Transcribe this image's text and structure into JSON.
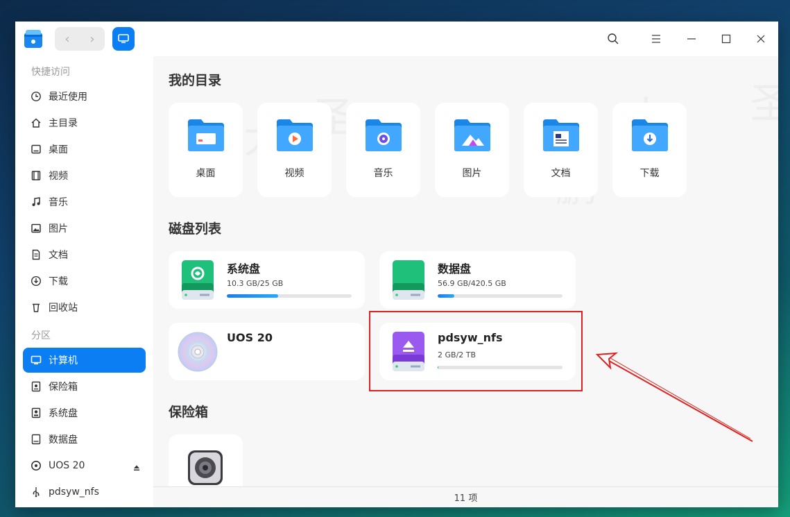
{
  "sidebar": {
    "quick_access_header": "快捷访问",
    "quick_items": [
      {
        "label": "最近使用",
        "icon": "clock-icon"
      },
      {
        "label": "主目录",
        "icon": "home-icon"
      },
      {
        "label": "桌面",
        "icon": "desktop-icon"
      },
      {
        "label": "视频",
        "icon": "video-icon"
      },
      {
        "label": "音乐",
        "icon": "music-icon"
      },
      {
        "label": "图片",
        "icon": "image-icon"
      },
      {
        "label": "文档",
        "icon": "document-icon"
      },
      {
        "label": "下载",
        "icon": "download-icon"
      },
      {
        "label": "回收站",
        "icon": "trash-icon"
      }
    ],
    "partition_header": "分区",
    "partition_items": [
      {
        "label": "计算机",
        "icon": "computer-icon",
        "active": true
      },
      {
        "label": "保险箱",
        "icon": "safe-icon"
      },
      {
        "label": "系统盘",
        "icon": "disk-icon"
      },
      {
        "label": "数据盘",
        "icon": "disk-icon"
      },
      {
        "label": "UOS 20",
        "icon": "cd-icon"
      },
      {
        "label": "pdsyw_nfs",
        "icon": "usb-icon"
      }
    ]
  },
  "main": {
    "my_dirs_title": "我的目录",
    "dirs": [
      {
        "label": "桌面",
        "icon": "desktop-folder-icon"
      },
      {
        "label": "视频",
        "icon": "video-folder-icon"
      },
      {
        "label": "音乐",
        "icon": "music-folder-icon"
      },
      {
        "label": "图片",
        "icon": "image-folder-icon"
      },
      {
        "label": "文档",
        "icon": "document-folder-icon"
      },
      {
        "label": "下载",
        "icon": "download-folder-icon"
      }
    ],
    "disk_list_title": "磁盘列表",
    "disks": [
      {
        "name": "系统盘",
        "size": "10.3 GB/25 GB",
        "usage": 0.41,
        "icon": "system-disk-icon"
      },
      {
        "name": "数据盘",
        "size": "56.9 GB/420.5 GB",
        "usage": 0.135,
        "icon": "data-disk-icon"
      },
      {
        "name": "UOS 20",
        "size": "",
        "usage": null,
        "icon": "cd-disk-icon"
      },
      {
        "name": "pdsyw_nfs",
        "size": "2 GB/2 TB",
        "usage": 0.001,
        "icon": "nfs-disk-icon"
      }
    ],
    "safe_title": "保险箱"
  },
  "statusbar": {
    "count": "11 项"
  },
  "colors": {
    "accent": "#0a7ef2",
    "highlight": "#e02020",
    "green_disk": "#1ec07a",
    "purple_disk": "#8a4ee8"
  }
}
